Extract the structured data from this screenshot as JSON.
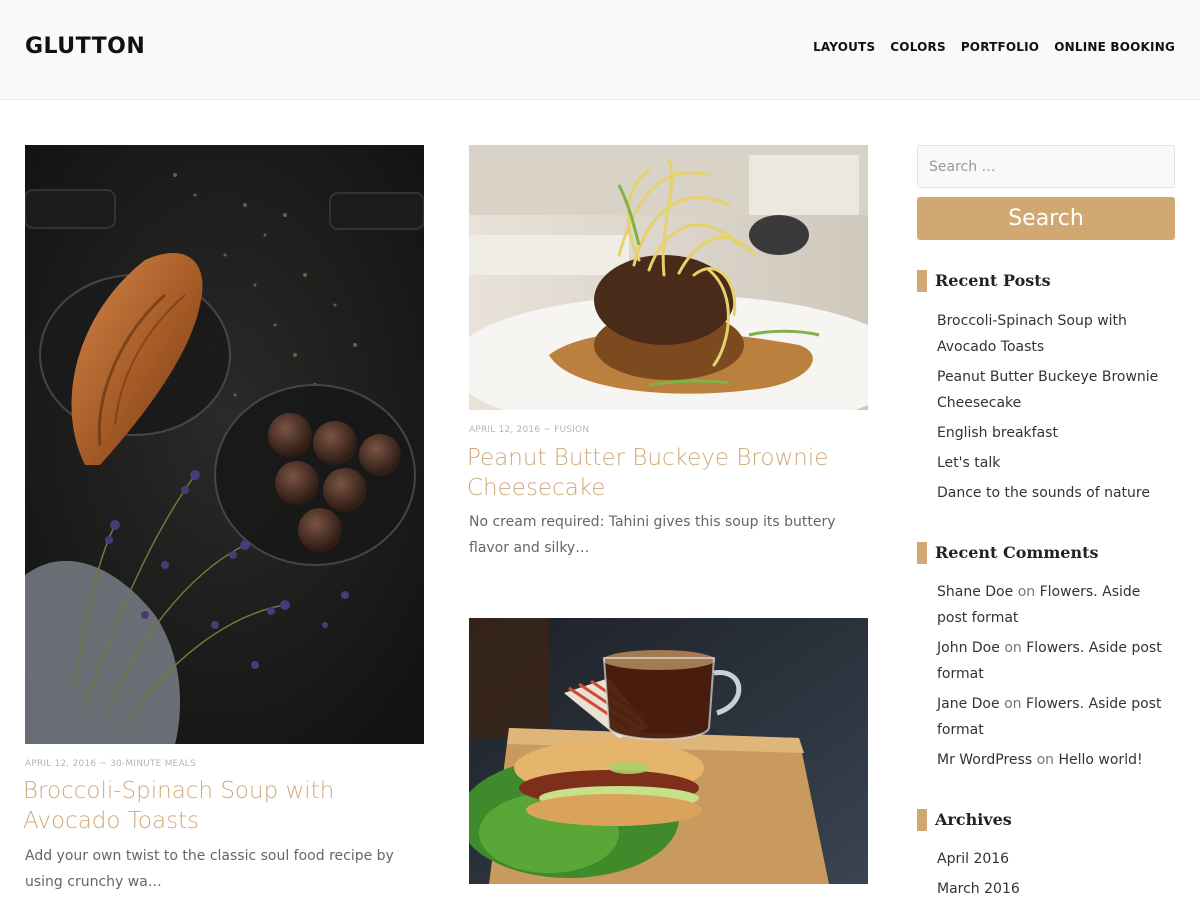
{
  "site": {
    "title": "GLUTTON"
  },
  "nav": [
    {
      "label": "LAYOUTS"
    },
    {
      "label": "COLORS"
    },
    {
      "label": "PORTFOLIO"
    },
    {
      "label": "ONLINE BOOKING"
    }
  ],
  "posts": [
    {
      "meta": "APRIL 12, 2016 ~ 30-MINUTE MEALS",
      "title": "Broccoli-Spinach Soup with Avocado Toasts",
      "excerpt": "Add your own twist to the classic soul food recipe by using crunchy wa…"
    },
    {
      "meta": "APRIL 12, 2016 ~ FUSION",
      "title": "Peanut Butter Buckeye Brownie Cheesecake",
      "excerpt": "No cream required: Tahini gives this soup its buttery flavor and silky…"
    }
  ],
  "sidebar": {
    "search": {
      "placeholder": "Search …",
      "button_label": "Search"
    },
    "recent_posts": {
      "title": "Recent Posts",
      "items": [
        "Broccoli-Spinach Soup with Avocado Toasts",
        "Peanut Butter Buckeye Brownie Cheesecake",
        "English breakfast",
        "Let's talk",
        "Dance to the sounds of nature"
      ]
    },
    "recent_comments": {
      "title": "Recent Comments",
      "on_word": "on",
      "items": [
        {
          "author": "Shane Doe",
          "post": "Flowers. Aside post format"
        },
        {
          "author": "John Doe",
          "post": "Flowers. Aside post format"
        },
        {
          "author": "Jane Doe",
          "post": "Flowers. Aside post format"
        },
        {
          "author": "Mr WordPress",
          "post": "Hello world!"
        }
      ]
    },
    "archives": {
      "title": "Archives",
      "items": [
        "April 2016",
        "March 2016"
      ]
    }
  },
  "colors": {
    "accent": "#d0a872",
    "post_title": "#cfa97a",
    "header_bg": "#f9f9f9"
  }
}
